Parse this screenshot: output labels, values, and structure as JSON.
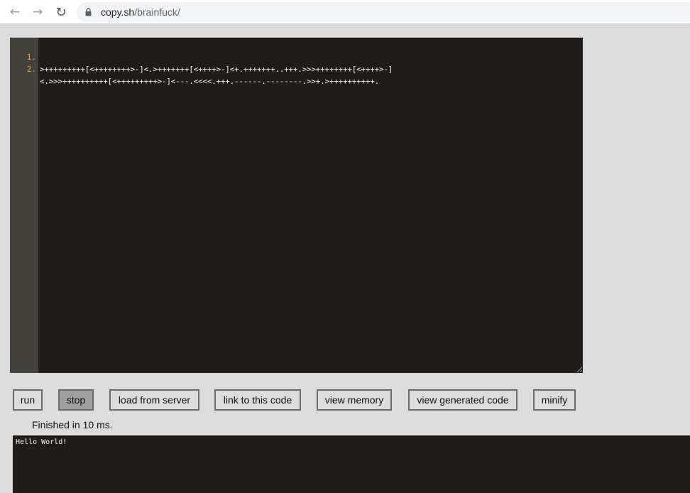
{
  "browser": {
    "url_host": "copy.sh",
    "url_path": "/brainfuck/",
    "back_icon": "arrow-left-icon",
    "forward_icon": "arrow-right-icon",
    "reload_icon": "reload-icon",
    "lock_icon": "lock-icon"
  },
  "editor": {
    "lines": [
      {
        "num": "1.",
        "code": ">+++++++++[<++++++++>-]<.>+++++++[<++++>-]<+.+++++++..+++.>>>++++++++[<++++>-]"
      },
      {
        "num": "2.",
        "code": "<.>>>++++++++++[<+++++++++>-]<---.<<<<.+++.------.--------.>>+.>++++++++++."
      }
    ]
  },
  "buttons": {
    "run": "run",
    "stop": "stop",
    "load": "load from server",
    "link": "link to this code",
    "memory": "view memory",
    "generated": "view generated code",
    "minify": "minify"
  },
  "status": "Finished in 10 ms.",
  "output": "Hello World!",
  "colors": {
    "editor_bg": "#201c1a",
    "gutter_bg": "#43413c",
    "line_number": "#e8a93c",
    "stop_button_bg": "#9e9e9e"
  }
}
